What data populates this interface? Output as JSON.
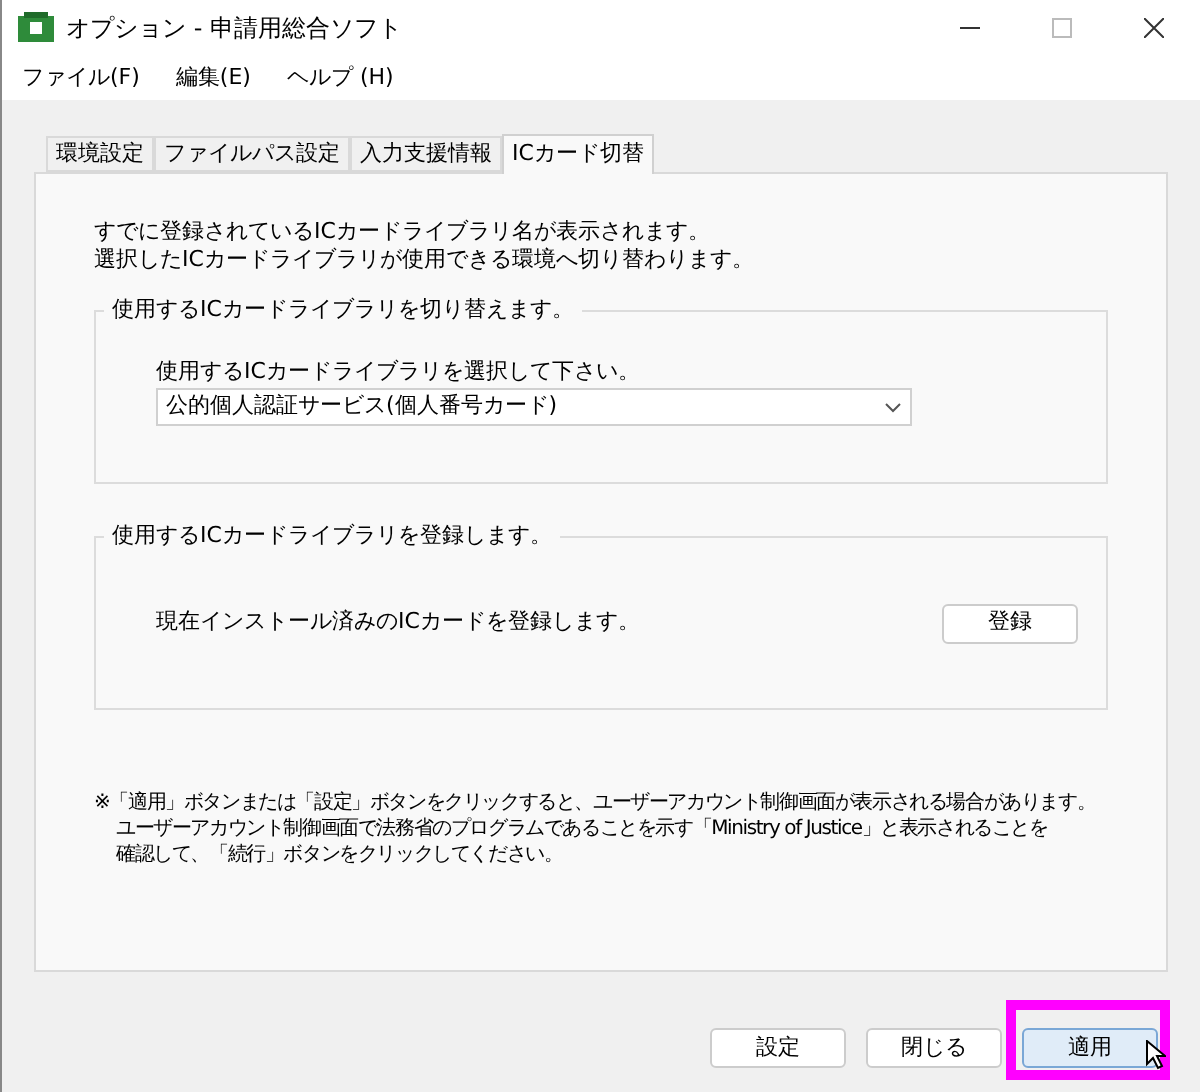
{
  "window": {
    "title": "オプション - 申請用総合ソフト"
  },
  "menu": [
    "ファイル(F)",
    "編集(E)",
    "ヘルプ (H)"
  ],
  "tabs": [
    {
      "label": "環境設定",
      "selected": false
    },
    {
      "label": "ファイルパス設定",
      "selected": false
    },
    {
      "label": "入力支援情報",
      "selected": false
    },
    {
      "label": "ICカード切替",
      "selected": true
    }
  ],
  "intro": [
    "すでに登録されているICカードライブラリ名が表示されます。",
    "選択したICカードライブラリが使用できる環境へ切り替わります。"
  ],
  "switch_group": {
    "title": "使用するICカードライブラリを切り替えます。",
    "label": "使用するICカードライブラリを選択して下さい。",
    "value": "公的個人認証サービス(個人番号カード)"
  },
  "register_group": {
    "title": "使用するICカードライブラリを登録します。",
    "label": "現在インストール済みのICカードを登録します。",
    "button": "登録"
  },
  "notice": [
    "※「適用」ボタンまたは「設定」ボタンをクリックすると、ユーザーアカウント制御画面が表示される場合があります。",
    "ユーザーアカウント制御画面で法務省のプログラムであることを示す「Ministry of Justice」と表示されることを",
    "確認して、「続行」ボタンをクリックしてください。"
  ],
  "buttons": [
    {
      "label": "設定",
      "highlighted": false
    },
    {
      "label": "閉じる",
      "highlighted": false
    },
    {
      "label": "適用",
      "highlighted": true
    }
  ]
}
